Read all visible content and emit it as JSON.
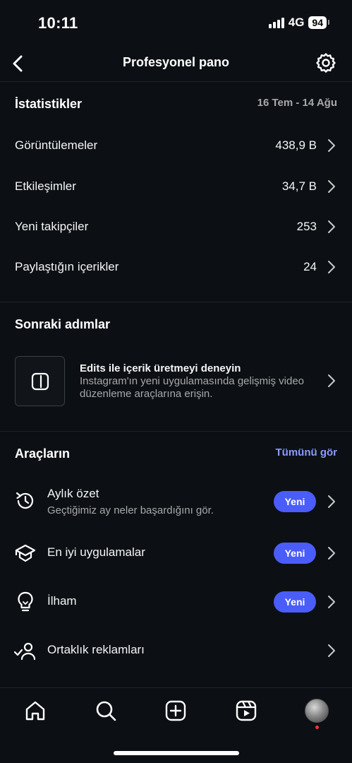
{
  "status_bar": {
    "time": "10:11",
    "network": "4G",
    "battery": "94"
  },
  "header": {
    "title": "Profesyonel pano",
    "back_icon": "chevron-left-icon",
    "settings_icon": "gear-icon"
  },
  "statistics": {
    "title": "İstatistikler",
    "date_range": "16 Tem - 14 Ağu",
    "rows": [
      {
        "label": "Görüntülemeler",
        "value": "438,9 B"
      },
      {
        "label": "Etkileşimler",
        "value": "34,7 B"
      },
      {
        "label": "Yeni takipçiler",
        "value": "253"
      },
      {
        "label": "Paylaştığın içerikler",
        "value": "24"
      }
    ]
  },
  "next_steps": {
    "title": "Sonraki adımlar",
    "card": {
      "title": "Edits ile içerik üretmeyi deneyin",
      "description": "Instagram'ın yeni uygulamasında gelişmiş video düzenleme araçlarına erişin.",
      "icon": "edits-app-icon"
    }
  },
  "tools": {
    "title": "Araçların",
    "see_all": "Tümünü gör",
    "items": [
      {
        "title": "Aylık özet",
        "subtitle": "Geçtiğimiz ay neler başardığını gör.",
        "badge": "Yeni",
        "icon": "history-icon"
      },
      {
        "title": "En iyi uygulamalar",
        "badge": "Yeni",
        "icon": "graduation-cap-icon"
      },
      {
        "title": "İlham",
        "badge": "Yeni",
        "icon": "lightbulb-icon"
      },
      {
        "title": "Ortaklık reklamları",
        "icon": "partner-check-icon"
      }
    ]
  },
  "tab_bar": {
    "icons": [
      "home-icon",
      "search-icon",
      "create-icon",
      "reels-icon",
      "profile-avatar"
    ]
  },
  "colors": {
    "background": "#0c1014",
    "accent": "#4a5df9",
    "link": "#8a9bff",
    "muted": "#a8a8a8"
  }
}
